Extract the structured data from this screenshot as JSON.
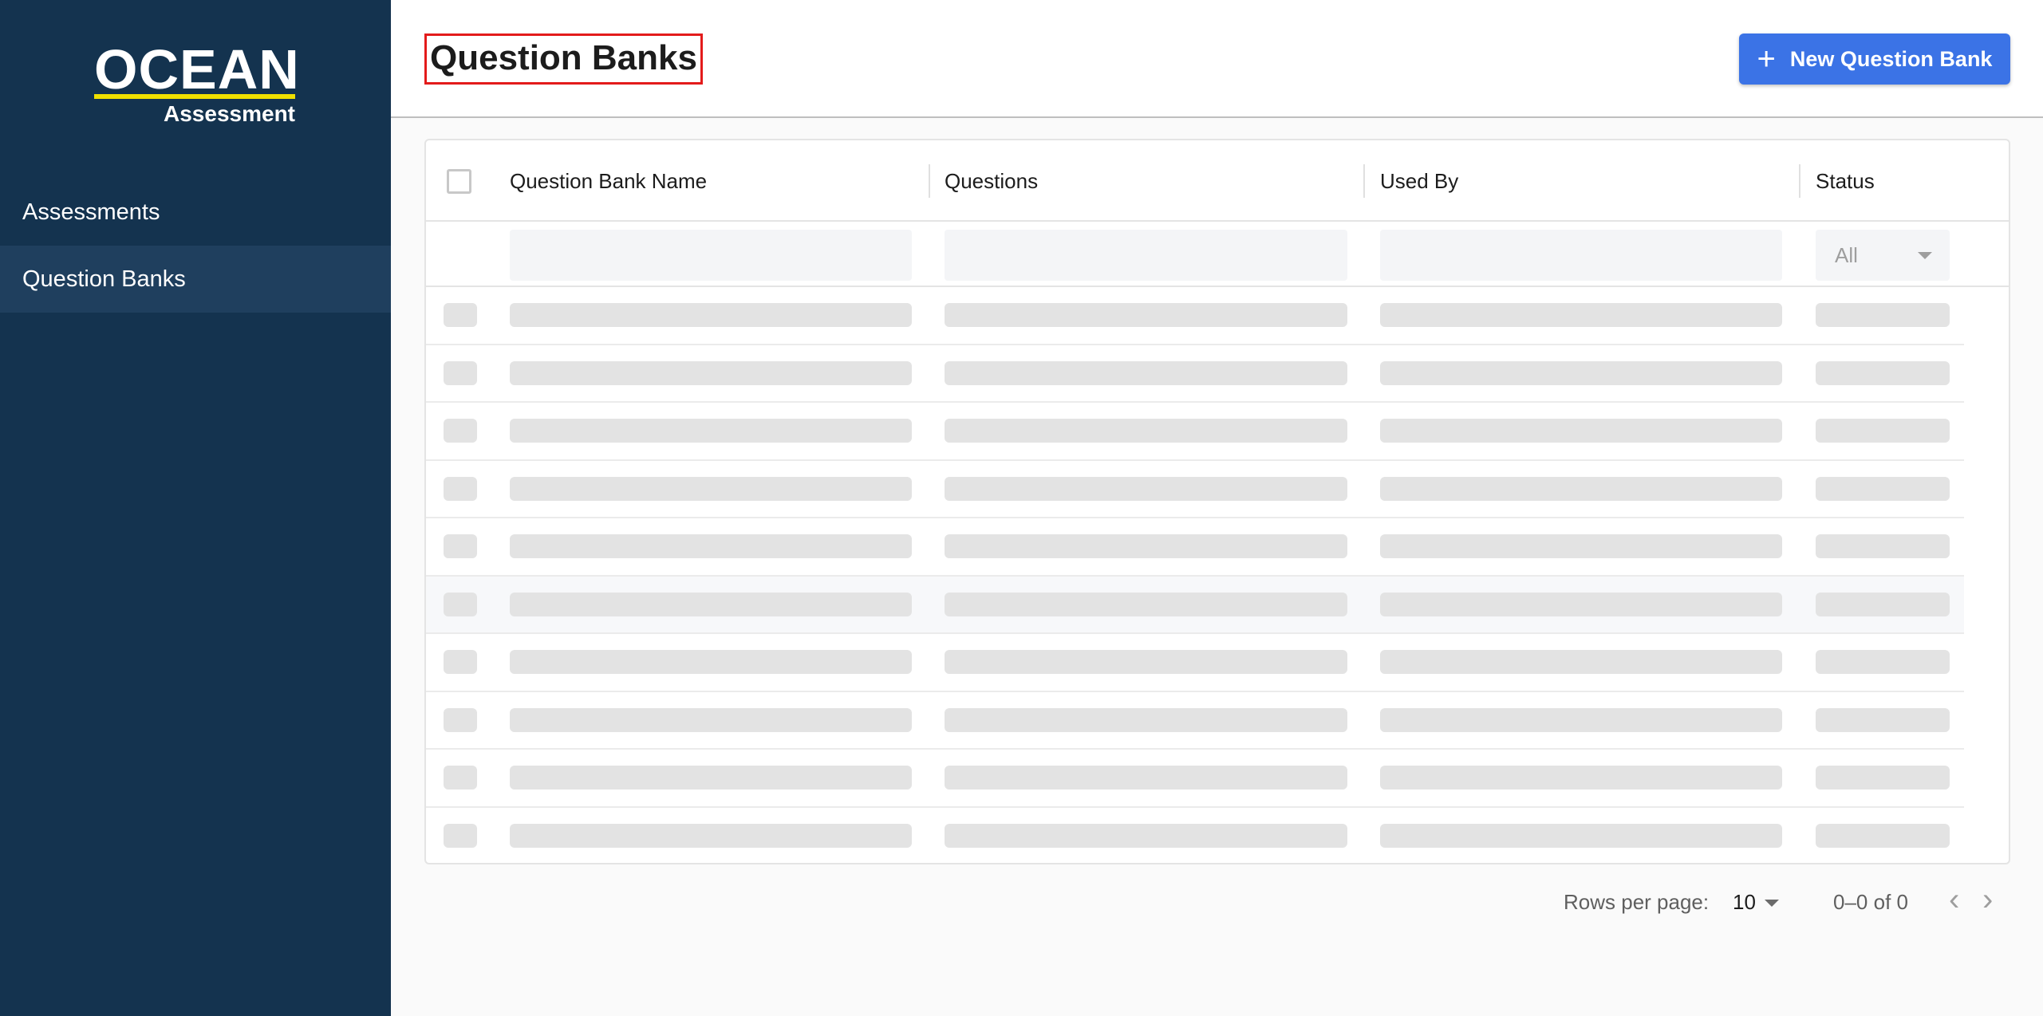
{
  "logo": {
    "word": "OCEAN",
    "subtitle": "Assessment",
    "accent_color": "#f0e000"
  },
  "sidebar": {
    "background": "#14334f",
    "items": [
      {
        "label": "Assessments",
        "active": false
      },
      {
        "label": "Question Banks",
        "active": true
      }
    ]
  },
  "header": {
    "title": "Question Banks",
    "new_button_label": "New Question Bank",
    "new_button_icon": "plus-icon",
    "primary_color": "#3b73e6"
  },
  "table": {
    "columns": [
      "Question Bank Name",
      "Questions",
      "Used By",
      "Status"
    ],
    "status_filter": {
      "selected": "All"
    },
    "loading_rows": 10
  },
  "pagination": {
    "rows_per_page_label": "Rows per page:",
    "rows_per_page": "10",
    "range_text": "0–0 of 0",
    "prev_icon": "chevron-left-icon",
    "next_icon": "chevron-right-icon"
  }
}
